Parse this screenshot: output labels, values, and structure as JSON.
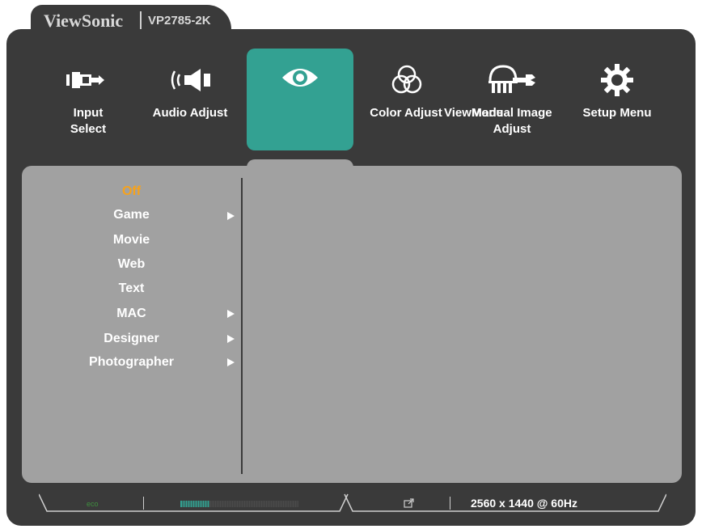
{
  "brand": {
    "name": "ViewSonic",
    "model": "VP2785-2K"
  },
  "tabs": [
    {
      "label": "Input Select",
      "icon": "input-select-icon",
      "active": false
    },
    {
      "label": "Audio Adjust",
      "icon": "audio-adjust-icon",
      "active": false
    },
    {
      "label": "",
      "icon": "eye-icon",
      "active": true
    },
    {
      "label": "Color Adjust",
      "icon": "color-adjust-icon",
      "active": false
    },
    {
      "label": "ViewMode",
      "icon": "",
      "active": false
    },
    {
      "label": "Manual Image Adjust",
      "icon": "manual-image-adjust-icon",
      "active": false
    },
    {
      "label": "Setup Menu",
      "icon": "gear-icon",
      "active": false
    }
  ],
  "submenu": {
    "items": [
      {
        "label": "Off",
        "selected": true,
        "has_submenu": false
      },
      {
        "label": "Game",
        "selected": false,
        "has_submenu": true
      },
      {
        "label": "Movie",
        "selected": false,
        "has_submenu": false
      },
      {
        "label": "Web",
        "selected": false,
        "has_submenu": false
      },
      {
        "label": "Text",
        "selected": false,
        "has_submenu": false
      },
      {
        "label": "MAC",
        "selected": false,
        "has_submenu": true
      },
      {
        "label": "Designer",
        "selected": false,
        "has_submenu": true
      },
      {
        "label": "Photographer",
        "selected": false,
        "has_submenu": true
      }
    ]
  },
  "status": {
    "eco_icon": "eco-icon",
    "eco_label": "eco",
    "signal_icon": "input-signal-icon",
    "resolution": "2560 x 1440 @ 60Hz",
    "level_fraction": 0.25
  },
  "colors": {
    "frame": "#3a3a3a",
    "accent": "#33a192",
    "panel": "#a1a1a1",
    "selected_text": "#f7a21b"
  }
}
